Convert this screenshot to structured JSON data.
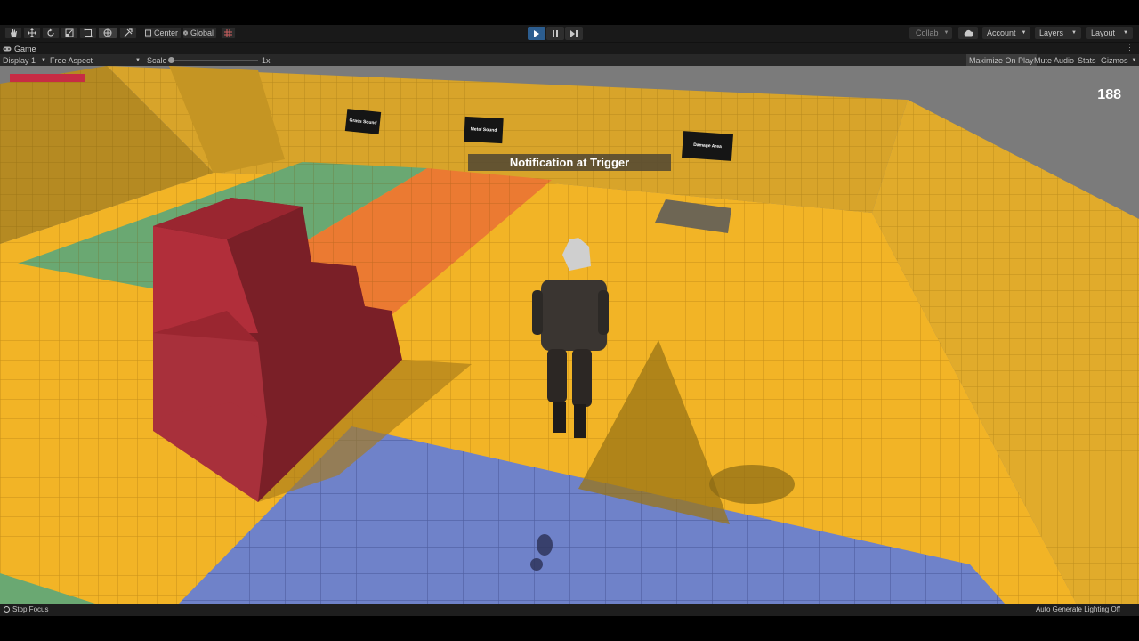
{
  "toolbar": {
    "tools": [
      "hand-tool",
      "move-tool",
      "rotate-tool",
      "scale-tool",
      "rect-tool",
      "transform-tool",
      "custom-tool"
    ],
    "pivot_label": "Center",
    "space_label": "Global",
    "collab_label": "Collab",
    "account_label": "Account",
    "layers_label": "Layers",
    "layout_label": "Layout"
  },
  "tab": {
    "label": "Game"
  },
  "controls": {
    "display": "Display 1",
    "aspect": "Free Aspect",
    "scale_label": "Scale",
    "scale_value": "1x",
    "maximize": "Maximize On Play",
    "mute": "Mute Audio",
    "stats": "Stats",
    "gizmos": "Gizmos"
  },
  "game": {
    "score": "188",
    "notification": "Notification at Trigger",
    "health_fraction": 1.0,
    "signs": [
      "Grass Sound",
      "Metal Sound",
      "Damage Area"
    ]
  },
  "status": {
    "left": "Stop Focus",
    "right": "Auto Generate Lighting Off"
  },
  "colors": {
    "floor_yellow": "#f2b426",
    "wall_yellow": "#d9a52a",
    "grass_green": "#6aa872",
    "orange": "#eb7a32",
    "blue": "#6f82c9",
    "stairs_red": "#7a1f27",
    "health_red": "#c72c44",
    "play_blue": "#2c5d8f"
  }
}
